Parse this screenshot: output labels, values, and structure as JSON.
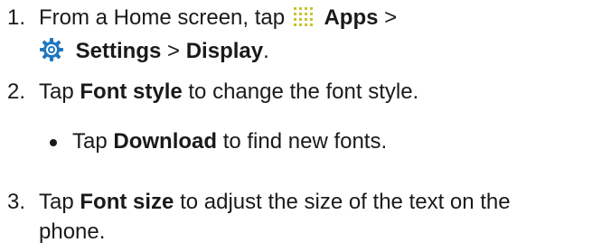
{
  "steps": [
    {
      "number": "1.",
      "pre": "From a Home screen, tap",
      "apps_label": "Apps",
      "sep1": ">",
      "settings_label": "Settings",
      "sep2": ">",
      "display_label": "Display",
      "end": "."
    },
    {
      "number": "2.",
      "pre": "Tap",
      "bold": "Font style",
      "post": "to change the font style.",
      "bullet": {
        "pre": "Tap",
        "bold": "Download",
        "post": "to find new fonts."
      }
    },
    {
      "number": "3.",
      "pre": "Tap",
      "bold": "Font size",
      "post": "to adjust the size of the text on the",
      "post2": "phone."
    }
  ],
  "icons": {
    "apps": "apps-grid-icon",
    "settings": "settings-gear-icon"
  },
  "colors": {
    "text": "#1a1a1a",
    "apps_icon": "#c8c232",
    "settings_icon": "#1f77bf"
  }
}
